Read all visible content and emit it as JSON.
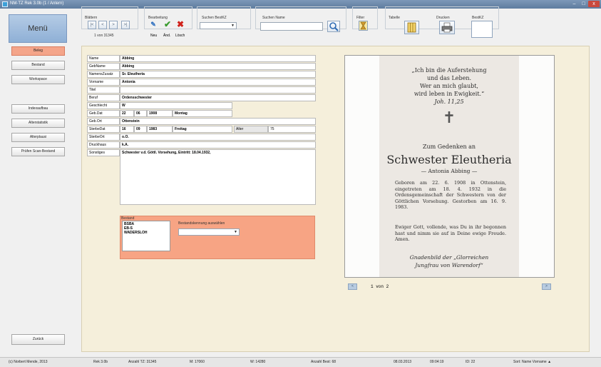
{
  "window": {
    "title": "NM-TZ Rek 3.0b (1 / Anlern)",
    "min": "–",
    "max": "□",
    "close": "x"
  },
  "menu": {
    "header": "Menü"
  },
  "toolbar": {
    "blaettern_label": "Blättern",
    "nav_first": "|<",
    "nav_prev": "<",
    "nav_next": ">",
    "nav_last": ">|",
    "record_count": "1 von 31345",
    "bearbeitung_label": "Bearbeitung",
    "edit_labels": {
      "new": "Neu",
      "change": "Änd.",
      "delete": "Lösch"
    },
    "suchen_bestkz_label": "Suchen BestKZ",
    "suchen_name_label": "Suchen Name",
    "search_name_value": "",
    "filter_label": "Filter",
    "tabelle_label": "Tabelle",
    "drucken_label": "Drucken",
    "bestkz_label": "BestKZ"
  },
  "sidebar": {
    "items": [
      {
        "label": "Beleg"
      },
      {
        "label": "Bestand"
      },
      {
        "label": "Workspace"
      },
      {
        "label": "Indexaufbau"
      },
      {
        "label": "Alterstatistik"
      },
      {
        "label": "Alterplausi"
      },
      {
        "label": "Prüfen Scan-Bestand"
      }
    ],
    "back": "Zurück"
  },
  "record": {
    "fields": [
      {
        "label": "Name",
        "value": "Abbing"
      },
      {
        "label": "GebName",
        "value": "Abbing"
      },
      {
        "label": "NamensZusatz",
        "value": "Sr. Eleutheria"
      },
      {
        "label": "Vorname",
        "value": "Antonia"
      },
      {
        "label": "Titel",
        "value": ""
      },
      {
        "label": "Beruf",
        "value": "Ordensschwester"
      },
      {
        "label": "Geschlecht",
        "value": "W"
      }
    ],
    "geb_dat": {
      "label": "Geb.Dat",
      "day": "22",
      "month": "06",
      "year": "1908",
      "weekday": "Montag"
    },
    "geb_ort": {
      "label": "Geb.Ort",
      "value": "Ottenstein"
    },
    "sterbe_dat": {
      "label": "SterbeDat",
      "day": "16",
      "month": "09",
      "year": "1983",
      "weekday": "Freitag",
      "alter_label": "Alter",
      "alter_value": "75"
    },
    "sterbe_ort": {
      "label": "SterbeOrt",
      "value": "o.O."
    },
    "druckhaus": {
      "label": "Druckhaus",
      "value": "k.A."
    },
    "sonstiges": {
      "label": "Sonstiges",
      "value": "Schwester v.d. Göttl. Vorsehung, Eintritt: 18.04.1932,"
    }
  },
  "bestand": {
    "title": "Bestand",
    "list": [
      "BSBA",
      "EB-S",
      "WADERSLOH"
    ],
    "combo_label": "Bestandskennung auswählen"
  },
  "card": {
    "quote_lines": [
      "„Ich bin die Auferstehung",
      "und das Leben.",
      "Wer an mich glaubt,",
      "wird leben in Ewigkeit.“",
      "Joh. 11,25"
    ],
    "cross": "✝",
    "gedenken": "Zum Gedenken an",
    "name": "Schwester Eleutheria",
    "subname": "— Antonia Abbing —",
    "bio": "Geboren am 22. 6. 1908 in Ottenstein, eingetreten am 18. 4. 1932 in die Ordensgemeinschaft der Schwestern von der Göttlichen Vorsehung. Gestorben am 16. 9. 1983.",
    "prayer": "Ewiger Gott, vollende, was Du in ihr begonnen hast und nimm sie auf in Deine ewige Freude.      Amen.",
    "footer_lines": [
      "Gnadenbild der „Glorreichen",
      "Jungfrau von Warendorf“"
    ]
  },
  "image_nav": {
    "prev": "<",
    "next": ">",
    "page": "1 von 2"
  },
  "status": {
    "copyright": "(c) Norbert Mende, 2013",
    "version": "Rek 3.0b",
    "anzahl_tz": "Anzahl TZ: 31345",
    "m": "M: 17060",
    "w": "W: 14280",
    "anzahl_best": "Anzahl Best: 68",
    "date": "08.03.2013",
    "time": "09:04:19",
    "id": "ID: 22",
    "sort": "Sort: Name Vorname ▲"
  },
  "colors": {
    "active_nav": "#f4a58a",
    "bestand_bg": "#f7a484",
    "panel_bg": "#f5efdb"
  }
}
